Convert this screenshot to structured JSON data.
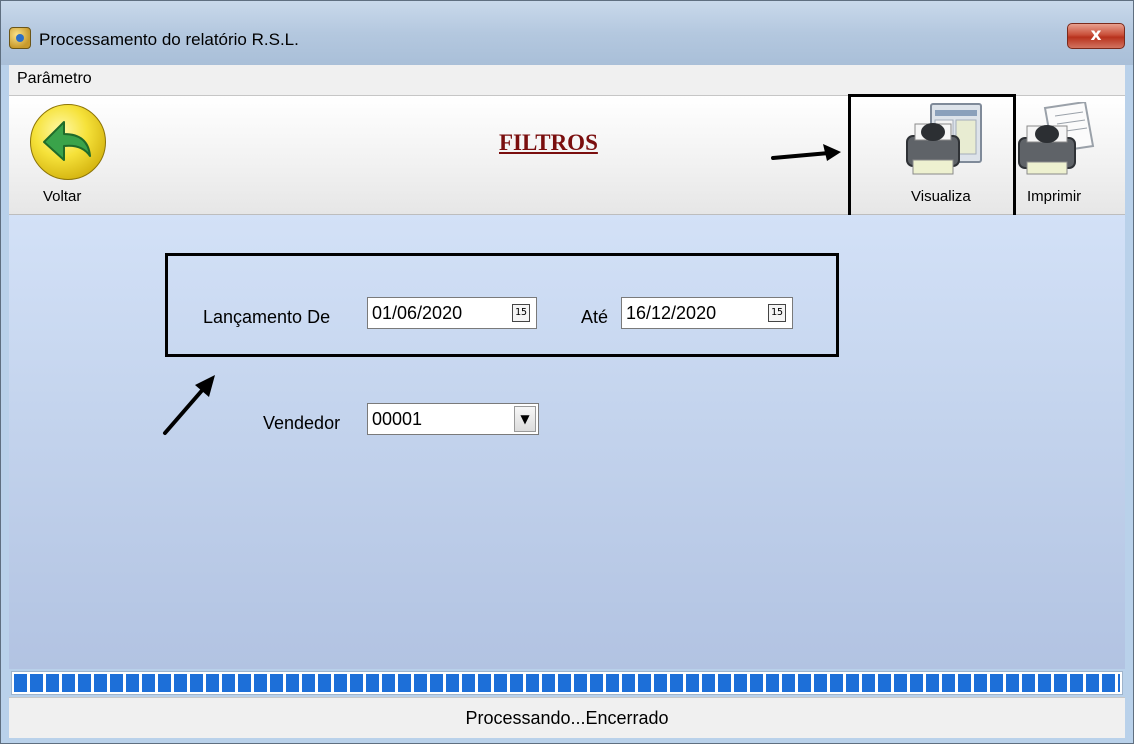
{
  "window": {
    "title": "Processamento do relatório R.S.L.",
    "close_label": "x"
  },
  "menu": {
    "items": [
      "Parâmetro"
    ]
  },
  "toolbar": {
    "back_label": "Voltar",
    "heading": "FILTROS",
    "preview_label": "Visualiza",
    "print_label": "Imprimir"
  },
  "filters": {
    "launch_from_label": "Lançamento De",
    "launch_from_value": "01/06/2020",
    "launch_to_label": "Até",
    "launch_to_value": "16/12/2020",
    "calendar_glyph": "15",
    "seller_label": "Vendedor",
    "seller_value": "00001",
    "dropdown_glyph": "▼"
  },
  "progress": {
    "fraction": 1.0
  },
  "status": {
    "text": "Processando...Encerrado"
  },
  "colors": {
    "heading": "#7a0e0e",
    "progress": "#1d6fd8",
    "close": "#c9503a"
  },
  "icons": {
    "app": "app-icon",
    "back": "back-arrow-icon",
    "preview": "print-preview-icon",
    "print": "printer-icon",
    "calendar": "calendar-icon",
    "dropdown": "chevron-down-icon"
  }
}
